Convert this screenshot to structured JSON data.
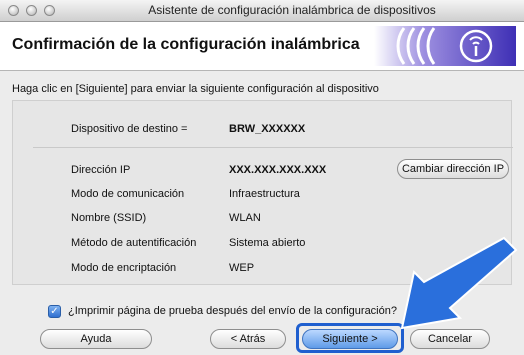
{
  "window": {
    "title": "Asistente de configuración inalámbrica de dispositivos"
  },
  "header": {
    "title": "Confirmación de la configuración inalámbrica",
    "logo_icon": "wireless-signal-icon"
  },
  "intro_text": "Haga clic en [Siguiente] para enviar la siguiente configuración al dispositivo",
  "settings": {
    "target": {
      "label": "Dispositivo de destino =",
      "value": "BRW_XXXXXX"
    },
    "rows": [
      {
        "label": "Dirección IP",
        "value": "XXX.XXX.XXX.XXX"
      },
      {
        "label": "Modo de comunicación",
        "value": "Infraestructura"
      },
      {
        "label": "Nombre (SSID)",
        "value": "WLAN"
      },
      {
        "label": "Método de autentificación",
        "value": "Sistema abierto"
      },
      {
        "label": "Modo de encriptación",
        "value": "WEP"
      }
    ],
    "change_ip_button": "Cambiar dirección IP"
  },
  "checkbox": {
    "label": "¿Imprimir página de prueba después del envío de la configuración?",
    "checked": true
  },
  "footer": {
    "help_button": "Ayuda",
    "back_button": "< Atrás",
    "next_button": "Siguiente >",
    "cancel_button": "Cancelar"
  },
  "colors": {
    "accent": "#1f5fcf",
    "arrow": "#2a6fdc"
  }
}
